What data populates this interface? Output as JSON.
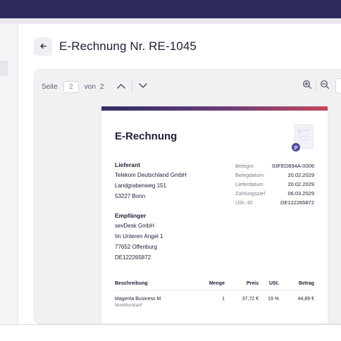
{
  "colors": {
    "topbar": "#2e2b5c",
    "accent_gradient": [
      "#2f2d66",
      "#c4485c"
    ]
  },
  "header": {
    "back_icon": "arrow-left-icon",
    "title": "E-Rechnung Nr. RE-1045"
  },
  "toolbar": {
    "page_label": "Seite",
    "page_value": "2",
    "of_label": "von",
    "total_pages": "2",
    "icons": [
      "chevron-up-icon",
      "chevron-down-icon",
      "zoom-in-icon",
      "zoom-out-icon"
    ]
  },
  "document": {
    "title": "E-Rechnung",
    "supplier": {
      "label": "Lieferant",
      "lines": [
        "Telekom Deutschland GmbH",
        "Landgrabenweg 151",
        "53227 Bonn"
      ]
    },
    "recipient": {
      "label": "Empfänger",
      "lines": [
        "sevDesk GmbH",
        "Im Unteren Angel 1",
        "77652 Offenburg",
        "DE122265872"
      ]
    },
    "meta": [
      {
        "key": "Belegnr.",
        "value": "93FED894A-0006"
      },
      {
        "key": "Belegdatum",
        "value": "20.02.2029"
      },
      {
        "key": "Lieferdatum",
        "value": "20.02.2029"
      },
      {
        "key": "Zahlungsziel",
        "value": "06.03.2029"
      },
      {
        "key": "USt.-ID",
        "value": "DE122265872"
      }
    ],
    "items": {
      "headers": {
        "description": "Beschreibung",
        "qty": "Menge",
        "price": "Preis",
        "tax": "USt.",
        "amount": "Betrag"
      },
      "rows": [
        {
          "description": "Magenta Business M",
          "sub": "Mobilfunktarif",
          "qty": "1",
          "price": "37,72 €",
          "tax": "19 %",
          "amount": "44,89 €"
        }
      ]
    }
  }
}
